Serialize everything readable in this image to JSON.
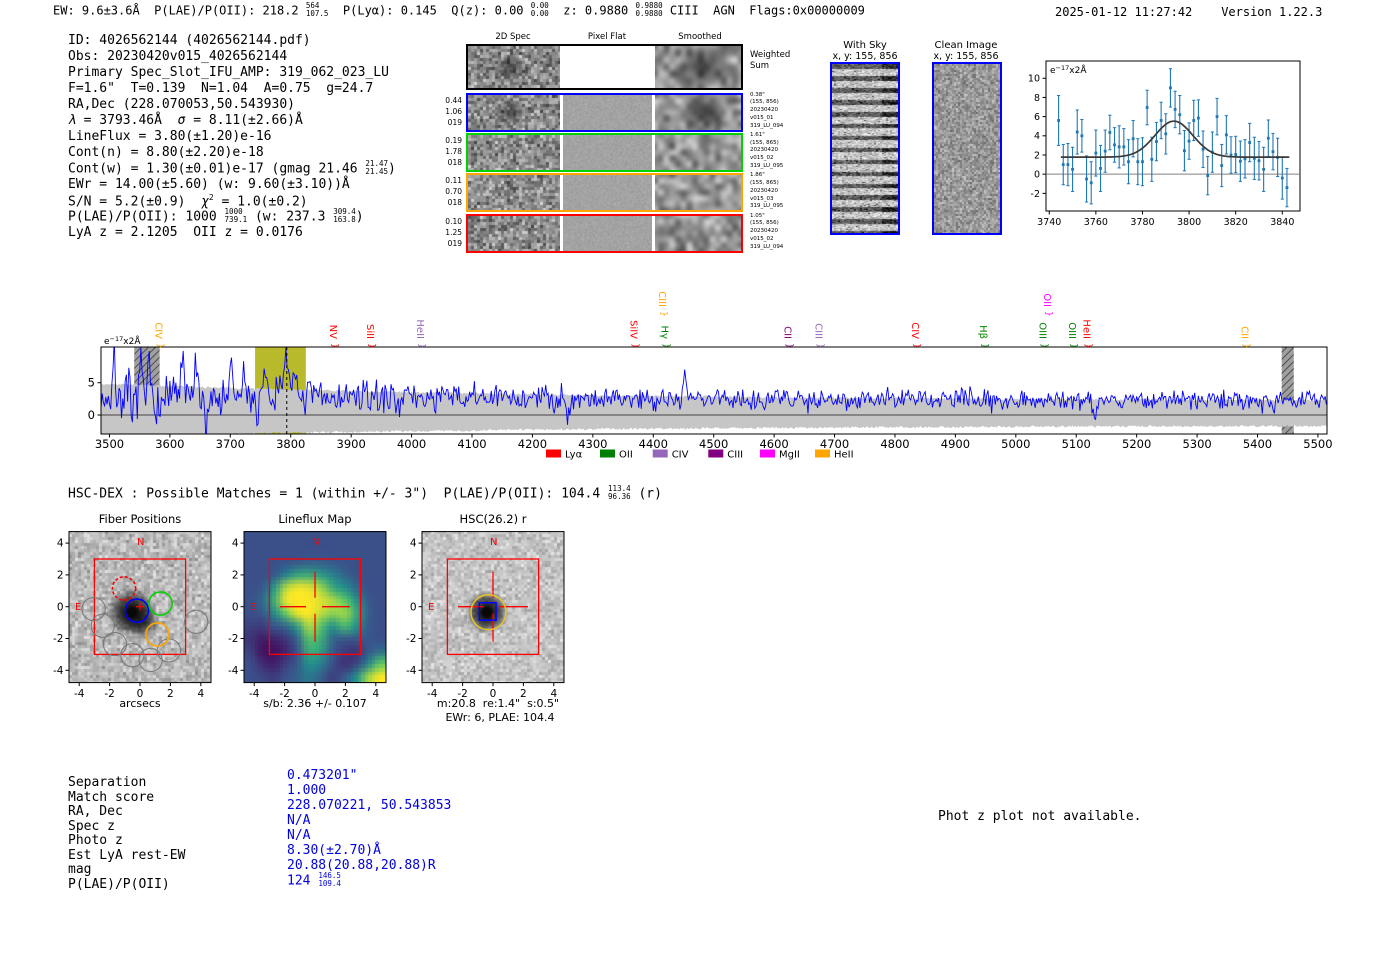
{
  "header": {
    "left_tokens": [
      {
        "t": "EW: 9.6±3.6Å  P(LAE)/P(OII): 218.2 "
      },
      {
        "f": [
          "564",
          "107.5"
        ]
      },
      {
        "t": "  P(Lyα): 0.145  Q(z): 0.00 "
      },
      {
        "f": [
          "0.00",
          "0.00"
        ]
      },
      {
        "t": "  z: 0.9880 "
      },
      {
        "f": [
          "0.9880",
          "0.9880"
        ]
      },
      {
        "t": " CIII  AGN  Flags:0x00000009"
      }
    ],
    "timestamp": "2025-01-12 11:27:42",
    "version": "Version 1.22.3"
  },
  "info_lines": [
    [
      {
        "t": "ID: 4026562144 (4026562144.pdf)"
      }
    ],
    [
      {
        "t": "Obs: 20230420v015_4026562144"
      }
    ],
    [
      {
        "t": "Primary Spec_Slot_IFU_AMP: 319_062_023_LU"
      }
    ],
    [
      {
        "t": "F=1.6\"  T=0.139  N=1.04  A=0.75  g=24.7"
      }
    ],
    [
      {
        "t": "RA,Dec (228.070053,50.543930)"
      }
    ],
    [
      {
        "i": "λ"
      },
      {
        "t": " = 3793.46Å  "
      },
      {
        "i": "σ"
      },
      {
        "t": " = 8.11(±2.66)Å"
      }
    ],
    [
      {
        "t": "LineFlux = 3.80(±1.20)e-16"
      }
    ],
    [
      {
        "t": "Cont(n) = 8.80(±2.20)e-18"
      }
    ],
    [
      {
        "t": "Cont(w) = 1.30(±0.01)e-17 (gmag 21.46 "
      },
      {
        "f": [
          "21.47",
          "21.45"
        ]
      },
      {
        "t": ")"
      }
    ],
    [
      {
        "t": "EWr = 14.00(±5.60) (w: 9.60(±3.10))Å"
      }
    ],
    [
      {
        "t": "S/N = 5.2(±0.9)  "
      },
      {
        "i": "χ"
      },
      {
        "sup": "2"
      },
      {
        "t": " = 1.0(±0.2)"
      }
    ],
    [
      {
        "t": "P(LAE)/P(OII): 1000 "
      },
      {
        "f": [
          "1000",
          "739.1"
        ]
      },
      {
        "t": " (w: 237.3 "
      },
      {
        "f": [
          "309.4",
          "163.8"
        ]
      },
      {
        "t": ")"
      }
    ],
    [
      {
        "t": "LyA z = 2.1205  OII z = 0.0176"
      }
    ]
  ],
  "spec2d": {
    "col_titles": [
      "2D Spec",
      "Pixel Flat",
      "Smoothed"
    ],
    "weighted_label": [
      "Weighted",
      "Sum"
    ],
    "rows": [
      {
        "color": "#0000ff",
        "left": [
          "0.44",
          "1.06",
          "019"
        ],
        "right": [
          "0.38\"",
          "(155, 856)",
          "20230420",
          "v015_01",
          "319_LU_094"
        ]
      },
      {
        "color": "#00d400",
        "left": [
          "0.19",
          "1.78",
          "018"
        ],
        "right": [
          "1.61\"",
          "(155, 865)",
          "20230420",
          "v015_02",
          "319_LU_095"
        ]
      },
      {
        "color": "#ffa500",
        "left": [
          "0.11",
          "0.70",
          "018"
        ],
        "right": [
          "1.86\"",
          "(155, 865)",
          "20230420",
          "v015_03",
          "319_LU_095"
        ]
      },
      {
        "color": "#ff0000",
        "left": [
          "0.10",
          "1.25",
          "019"
        ],
        "right": [
          "1.05\"",
          "(155, 856)",
          "20230420",
          "v015_02",
          "319_LU_094"
        ]
      }
    ]
  },
  "sky_panels": [
    {
      "title": "With Sky",
      "subtitle": "x, y: 155, 856"
    },
    {
      "title": "Clean Image",
      "subtitle": "x, y: 155, 856"
    }
  ],
  "hsc_line_tokens": [
    {
      "t": "HSC-DEX : Possible Matches = 1 (within +/- 3\")  P(LAE)/P(OII): 104.4 "
    },
    {
      "f": [
        "113.4",
        "96.36"
      ]
    },
    {
      "t": " (r)"
    }
  ],
  "chart_data": [
    {
      "type": "scatter",
      "name": "emission-line-fit",
      "unit_label": "e−17x2Å",
      "xlim": [
        3738.6,
        3847.6
      ],
      "ylim": [
        -3.84,
        11.8
      ],
      "xticks": [
        3740,
        3760,
        3780,
        3800,
        3820,
        3840
      ],
      "yticks": [
        -2,
        0,
        2,
        4,
        6,
        8,
        10
      ],
      "marker_color": "#1f77b4",
      "fit_color": "#3a3a3a",
      "fit": {
        "baseline": 1.78,
        "amplitude": 3.75,
        "center": 3793.5,
        "sigma": 8.1
      },
      "points": [
        [
          3744,
          5.6,
          2.6
        ],
        [
          3746,
          1.0,
          2.1
        ],
        [
          3748,
          1.0,
          2.2
        ],
        [
          3750,
          0.5,
          2.3
        ],
        [
          3752,
          4.4,
          2.3
        ],
        [
          3754,
          4.0,
          1.7
        ],
        [
          3756,
          -0.5,
          2.4
        ],
        [
          3758,
          -0.9,
          2.2
        ],
        [
          3760,
          2.2,
          2.4
        ],
        [
          3762,
          0.6,
          2.4
        ],
        [
          3764,
          2.4,
          2.2
        ],
        [
          3766,
          4.35,
          1.8
        ],
        [
          3768,
          3.05,
          1.8
        ],
        [
          3770,
          2.85,
          2.2
        ],
        [
          3772,
          2.85,
          1.9
        ],
        [
          3774,
          1.3,
          2.3
        ],
        [
          3776,
          3.7,
          1.9
        ],
        [
          3778,
          1.3,
          2.4
        ],
        [
          3780,
          1.3,
          2.5
        ],
        [
          3782,
          6.95,
          1.8
        ],
        [
          3784,
          1.55,
          2.3
        ],
        [
          3786,
          3.4,
          2.0
        ],
        [
          3788,
          5.6,
          1.9
        ],
        [
          3790,
          4.2,
          2.1
        ],
        [
          3792,
          9.0,
          2.0
        ],
        [
          3794,
          6.75,
          1.9
        ],
        [
          3796,
          6.2,
          2.0
        ],
        [
          3798,
          2.45,
          2.1
        ],
        [
          3800,
          3.45,
          1.9
        ],
        [
          3802,
          5.6,
          2.1
        ],
        [
          3804,
          5.85,
          1.9
        ],
        [
          3806,
          2.6,
          1.9
        ],
        [
          3808,
          -0.15,
          2.0
        ],
        [
          3810,
          2.3,
          2.1
        ],
        [
          3812,
          6.0,
          1.9
        ],
        [
          3814,
          0.9,
          2.2
        ],
        [
          3816,
          4.1,
          2.0
        ],
        [
          3818,
          2.0,
          1.9
        ],
        [
          3820,
          2.05,
          1.9
        ],
        [
          3822,
          1.35,
          2.1
        ],
        [
          3824,
          1.6,
          2.0
        ],
        [
          3826,
          3.3,
          2.0
        ],
        [
          3828,
          1.65,
          2.2
        ],
        [
          3830,
          1.4,
          2.0
        ],
        [
          3832,
          0.5,
          2.3
        ],
        [
          3834,
          3.75,
          1.9
        ],
        [
          3836,
          2.35,
          1.9
        ],
        [
          3838,
          1.75,
          2.0
        ],
        [
          3840,
          -0.4,
          2.2
        ],
        [
          3842,
          -1.4,
          2.0
        ]
      ]
    },
    {
      "type": "line",
      "name": "full-spectrum",
      "unit_label": "e−17x2Å",
      "xlim": [
        3486,
        5515
      ],
      "ylim": [
        -2.94,
        10.53
      ],
      "xticks": [
        3500,
        3600,
        3700,
        3800,
        3900,
        4000,
        4100,
        4200,
        4300,
        4400,
        4500,
        4600,
        4700,
        4800,
        4900,
        5000,
        5100,
        5200,
        5300,
        5400,
        5500
      ],
      "yticks": [
        0,
        5
      ],
      "line_color": "#0000ff",
      "envelope_color": "#c6c6c6",
      "envelope": {
        "top_base": 2.05,
        "top_amp": 2.75,
        "bottom_base": 1.55,
        "bottom_amp": 1.75,
        "decay_A": 800
      },
      "highlight_band": [
        3741,
        3825
      ],
      "highlight_color": "#b9b92c",
      "hatch_bands": [
        [
          3541,
          3583
        ],
        [
          5440,
          5460
        ]
      ],
      "dashed_line": 3793.46,
      "peak": {
        "center": 3793.46,
        "amplitude": 5.8,
        "sigma": 7.5
      },
      "continuum": {
        "start": 2.85,
        "slope_per_A": -0.0003
      },
      "noise_sigma": {
        "base": 0.7,
        "amp": 1.25,
        "decay_A": 520
      },
      "spikes": [
        [
          3508,
          5.2
        ],
        [
          3551,
          5.8
        ],
        [
          3566,
          4.2
        ],
        [
          3620,
          6.0
        ],
        [
          3642,
          4.2
        ],
        [
          3700,
          5.2
        ],
        [
          3722,
          3.8
        ],
        [
          3759,
          4.0
        ],
        [
          4452,
          4.2
        ]
      ],
      "dips": [
        [
          3538,
          -4.2
        ],
        [
          3585,
          -3.6
        ],
        [
          3660,
          -4.6
        ],
        [
          3745,
          -3.8
        ],
        [
          4258,
          -2.6
        ],
        [
          5130,
          -3.0
        ]
      ],
      "emission_labels": [
        {
          "wl": 3583,
          "text": "CIV",
          "color": "#ffa500",
          "raised": false
        },
        {
          "wl": 3872,
          "text": "NV",
          "color": "#ff0000",
          "raised": false
        },
        {
          "wl": 3933,
          "text": "SiII",
          "color": "#ff0000",
          "raised": false
        },
        {
          "wl": 4016,
          "text": "HeII",
          "color": "#9467bd",
          "raised": false
        },
        {
          "wl": 4369,
          "text": "SiIV",
          "color": "#ff0000",
          "raised": false
        },
        {
          "wl": 4416,
          "text": "CIII",
          "color": "#ffa500",
          "raised": true
        },
        {
          "wl": 4420,
          "text": "Hγ",
          "color": "#008000",
          "raised": false
        },
        {
          "wl": 4624,
          "text": "CII",
          "color": "#800080",
          "raised": false
        },
        {
          "wl": 4675,
          "text": "CIII",
          "color": "#9467bd",
          "raised": false
        },
        {
          "wl": 4835,
          "text": "CIV",
          "color": "#ff0000",
          "raised": false
        },
        {
          "wl": 4947,
          "text": "Hβ",
          "color": "#008000",
          "raised": false
        },
        {
          "wl": 5046,
          "text": "OIII",
          "color": "#008000",
          "raised": false
        },
        {
          "wl": 5053,
          "text": "OII",
          "color": "#ff00ff",
          "raised": true
        },
        {
          "wl": 5095,
          "text": "OIII",
          "color": "#008000",
          "raised": false
        },
        {
          "wl": 5119,
          "text": "HeII",
          "color": "#ff0000",
          "raised": false
        },
        {
          "wl": 5380,
          "text": "CII",
          "color": "#ffa500",
          "raised": false
        }
      ],
      "legend": [
        {
          "label": "Lyα",
          "color": "#ff0000"
        },
        {
          "label": "OII",
          "color": "#008000"
        },
        {
          "label": "CIV",
          "color": "#9467bd"
        },
        {
          "label": "CIII",
          "color": "#800080"
        },
        {
          "label": "MgII",
          "color": "#ff00ff"
        },
        {
          "label": "HeII",
          "color": "#ffa500"
        }
      ]
    },
    {
      "type": "cutouts",
      "panels": [
        {
          "title": "Fiber Positions",
          "caption": "arcsecs",
          "xticks": [
            -4,
            -2,
            0,
            2,
            4
          ],
          "yticks": [
            4,
            2,
            0,
            -2,
            -4
          ],
          "compass": [
            "N",
            "E"
          ]
        },
        {
          "title": "Lineflux Map",
          "caption": "s/b: 2.36 +/- 0.107",
          "xticks": [
            -4,
            -2,
            0,
            2,
            4
          ],
          "yticks": [
            4,
            2,
            0,
            -2,
            -4
          ],
          "compass": [
            "N",
            "E"
          ]
        },
        {
          "title": "HSC(26.2) r",
          "caption": "m:20.8  re:1.4\"  s:0.5\"",
          "caption2": "EWr: 6, PLAE: 104.4",
          "xticks": [
            -4,
            -2,
            0,
            2,
            4
          ],
          "yticks": [
            4,
            2,
            0,
            -2,
            -4
          ],
          "compass": [
            "N",
            "E"
          ]
        }
      ],
      "fibers": {
        "radius_arcsec": 0.75,
        "colored": [
          {
            "x": -1.05,
            "y": 1.15,
            "color": "#ff0000",
            "dashed": true
          },
          {
            "x": -0.2,
            "y": -0.25,
            "color": "#0000ff",
            "dashed": false
          },
          {
            "x": 1.35,
            "y": 0.2,
            "color": "#00d400",
            "dashed": false
          },
          {
            "x": 1.15,
            "y": -1.75,
            "color": "#ffa500",
            "dashed": false
          }
        ],
        "gray": [
          {
            "x": -2.45,
            "y": -1.2
          },
          {
            "x": -1.65,
            "y": -2.35
          },
          {
            "x": -0.5,
            "y": -3.05
          },
          {
            "x": 0.7,
            "y": -3.35
          },
          {
            "x": 1.9,
            "y": -2.75
          },
          {
            "x": -3.05,
            "y": -0.15
          },
          {
            "x": 3.7,
            "y": -0.95
          }
        ]
      },
      "hsc_overlays": {
        "yellow_circle": {
          "x": -0.3,
          "y": -0.35,
          "r": 1.15
        },
        "blue_square": {
          "x": -0.35,
          "y": -0.3,
          "size": 1.1
        }
      },
      "lineflux_map": {
        "palette": "viridis",
        "grid": [
          [
            0.24,
            0.24,
            0.24,
            0.24,
            0.24,
            0.24,
            0.24,
            0.24,
            0.24,
            0.24,
            0.24,
            0.24
          ],
          [
            0.24,
            0.24,
            0.24,
            0.24,
            0.24,
            0.24,
            0.24,
            0.24,
            0.24,
            0.24,
            0.24,
            0.24
          ],
          [
            0.24,
            0.24,
            0.24,
            0.25,
            0.27,
            0.3,
            0.3,
            0.27,
            0.25,
            0.24,
            0.24,
            0.24
          ],
          [
            0.24,
            0.24,
            0.27,
            0.45,
            0.6,
            0.62,
            0.55,
            0.45,
            0.33,
            0.25,
            0.24,
            0.24
          ],
          [
            0.24,
            0.27,
            0.5,
            0.88,
            0.98,
            0.96,
            0.85,
            0.6,
            0.5,
            0.33,
            0.24,
            0.24
          ],
          [
            0.25,
            0.33,
            0.6,
            0.98,
            1.0,
            1.0,
            0.95,
            0.88,
            0.75,
            0.5,
            0.28,
            0.24
          ],
          [
            0.24,
            0.27,
            0.45,
            0.75,
            0.97,
            1.0,
            0.9,
            0.82,
            0.86,
            0.6,
            0.3,
            0.24
          ],
          [
            0.2,
            0.18,
            0.26,
            0.33,
            0.55,
            0.88,
            0.72,
            0.5,
            0.68,
            0.5,
            0.28,
            0.24
          ],
          [
            0.16,
            0.09,
            0.11,
            0.17,
            0.32,
            0.72,
            0.62,
            0.33,
            0.28,
            0.28,
            0.26,
            0.24
          ],
          [
            0.2,
            0.06,
            0.04,
            0.11,
            0.25,
            0.62,
            0.56,
            0.28,
            0.18,
            0.15,
            0.28,
            0.36
          ],
          [
            0.24,
            0.14,
            0.09,
            0.19,
            0.28,
            0.5,
            0.42,
            0.24,
            0.15,
            0.21,
            0.45,
            0.75
          ],
          [
            0.24,
            0.22,
            0.18,
            0.25,
            0.31,
            0.4,
            0.3,
            0.19,
            0.28,
            0.5,
            0.85,
            1.0
          ]
        ]
      }
    }
  ],
  "match_table": {
    "labels": [
      "Separation",
      "Match score",
      "RA, Dec",
      "Spec z",
      "Photo z",
      "Est LyA rest-EW",
      "mag",
      "P(LAE)/P(OII)"
    ],
    "values": [
      [
        {
          "t": "0.473201\""
        }
      ],
      [
        {
          "t": "1.000"
        }
      ],
      [
        {
          "t": "228.070221, 50.543853"
        }
      ],
      [
        {
          "t": "N/A"
        }
      ],
      [
        {
          "t": "N/A"
        }
      ],
      [
        {
          "t": "8.30(±2.70)Å"
        }
      ],
      [
        {
          "t": "20.88(20.88,20.88)R"
        }
      ],
      [
        {
          "t": "124 "
        },
        {
          "f": [
            "146.5",
            "109.4"
          ]
        }
      ]
    ],
    "value_color": "#0000e0"
  },
  "photz_note": "Phot z plot not available."
}
